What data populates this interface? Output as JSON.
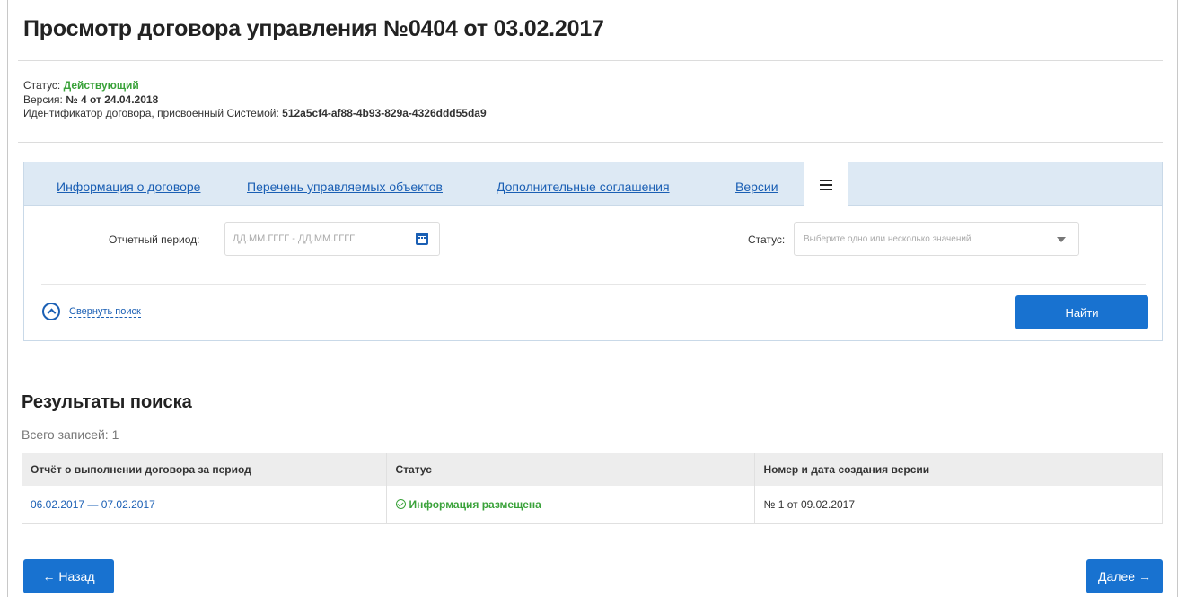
{
  "page": {
    "title": "Просмотр договора управления №0404 от 03.02.2017"
  },
  "meta": {
    "status_label": "Статус:",
    "status_value": "Действующий",
    "version_label": "Версия:",
    "version_value": "№ 4 от 24.04.2018",
    "id_label": "Идентификатор договора, присвоенный Системой:",
    "id_value": "512a5cf4-af88-4b93-829a-4326ddd55da9"
  },
  "tabs": [
    {
      "label": "Информация о договоре"
    },
    {
      "label": "Перечень управляемых объектов"
    },
    {
      "label": "Дополнительные соглашения"
    },
    {
      "label": "Версии"
    },
    {
      "icon": "list-icon",
      "active": true
    }
  ],
  "filters": {
    "period_label": "Отчетный период:",
    "period_placeholder": "ДД.ММ.ГГГГ - ДД.ММ.ГГГГ",
    "status_label": "Статус:",
    "status_placeholder": "Выберите одно или несколько значений",
    "collapse_label": "Свернуть поиск",
    "find_label": "Найти"
  },
  "results": {
    "title": "Результаты поиска",
    "count": "Всего записей: 1",
    "columns": [
      "Отчёт о выполнении договора за период",
      "Статус",
      "Номер и дата создания версии"
    ],
    "rows": [
      {
        "period": "06.02.2017 — 07.02.2017",
        "status": "Информация размещена",
        "version": "№ 1 от 09.02.2017"
      }
    ]
  },
  "nav": {
    "back_label": "← Назад",
    "next_label": "Далее →"
  },
  "colors": {
    "accent": "#1872d0",
    "link": "#1a5fb4",
    "success": "#3aa23a",
    "tabs_bg": "#dde9f4"
  }
}
